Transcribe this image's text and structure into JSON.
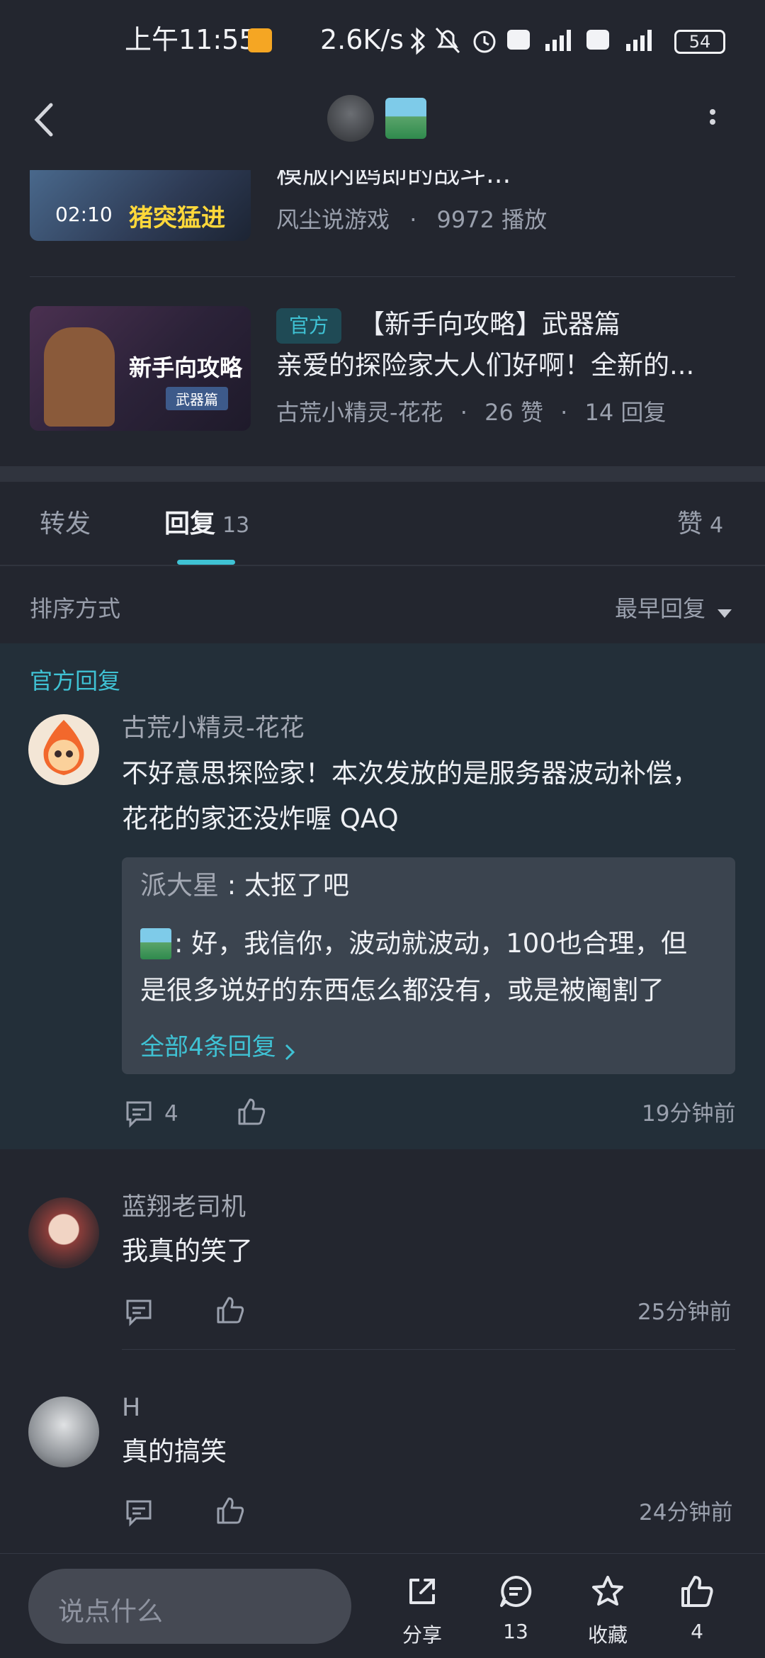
{
  "status_bar": {
    "time": "上午11:55",
    "network_speed": "2.6K/s",
    "battery": "54"
  },
  "header": {
    "back_icon": "chevron-left-icon",
    "more_icon": "more-vertical-icon"
  },
  "related_posts": [
    {
      "title": "模版内鸥即的战斗...",
      "duration": "02:10",
      "thumb_text": "猪突猛进",
      "author": "风尘说游戏",
      "plays": "9972 播放"
    },
    {
      "badge": "官方",
      "title": "【新手向攻略】武器篇",
      "excerpt": "亲爱的探险家大人们好啊！全新的...",
      "thumb_text": "新手向攻略",
      "thumb_sub": "武器篇",
      "author": "古荒小精灵-花花",
      "likes": "26 赞",
      "replies": "14 回复"
    }
  ],
  "tabs": {
    "forward": "转发",
    "reply": "回复",
    "reply_count": "13",
    "like": "赞",
    "like_count": "4"
  },
  "sort": {
    "label": "排序方式",
    "value": "最早回复"
  },
  "official_reply": {
    "section_label": "官方回复",
    "author": "古荒小精灵-花花",
    "text_line1": "不好意思探险家！本次发放的是服务器波动补偿，",
    "text_line2": "花花的家还没炸喔 QAQ",
    "sub_replies": [
      {
        "name": "派大星",
        "sep": " : ",
        "text": "太抠了吧"
      },
      {
        "sep": " : ",
        "text_line1": "好，我信你，波动就波动，100也合理，但",
        "text_line2": "是很多说好的东西怎么都没有，或是被阉割了"
      }
    ],
    "all_replies_link": "全部4条回复",
    "comment_count": "4",
    "time": "19分钟前"
  },
  "comments": [
    {
      "author": "蓝翔老司机",
      "text": "我真的笑了",
      "time": "25分钟前"
    },
    {
      "author": "H",
      "text": "真的搞笑",
      "time": "24分钟前"
    }
  ],
  "bottom_bar": {
    "input_placeholder": "说点什么",
    "share": "分享",
    "comments": "13",
    "favorite": "收藏",
    "likes": "4"
  },
  "colors": {
    "background": "#23262f",
    "official_bg": "#232f39",
    "accent": "#3fc2d4"
  }
}
